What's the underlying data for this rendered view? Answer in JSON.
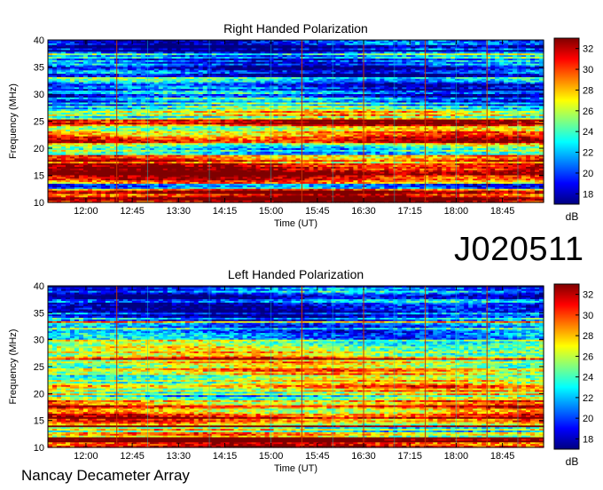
{
  "observation_id": "J020511",
  "instrument_label": "Nancay Decameter Array",
  "colors": {
    "colormap": [
      "#00007f",
      "#0000ff",
      "#0080ff",
      "#00ffff",
      "#80ff80",
      "#ffff00",
      "#ff8000",
      "#ff0000",
      "#7f0000"
    ],
    "reference_line": "#c83200",
    "hour_line": "#00dcdc"
  },
  "chart_data": [
    {
      "type": "heatmap",
      "title": "Right Handed Polarization",
      "xlabel": "Time (UT)",
      "ylabel": "Frequency (MHz)",
      "x_ticks": [
        "12:00",
        "12:45",
        "13:30",
        "14:15",
        "15:00",
        "15:45",
        "16:30",
        "17:15",
        "18:00",
        "18:45"
      ],
      "xlim": [
        "11:23",
        "19:25"
      ],
      "y_ticks": [
        10,
        15,
        20,
        25,
        30,
        35,
        40
      ],
      "ylim": [
        10,
        40
      ],
      "colorbar": {
        "label": "dB",
        "ticks": [
          18,
          20,
          22,
          24,
          26,
          28,
          30,
          32
        ],
        "range": [
          17,
          33
        ]
      },
      "reference_lines_ut": [
        "12:30",
        "15:30",
        "16:30",
        "17:30",
        "18:30"
      ],
      "band_profile": [
        {
          "freq": 11.5,
          "db": 32
        },
        {
          "freq": 13.0,
          "db": 22
        },
        {
          "freq": 15.0,
          "db": 33
        },
        {
          "freq": 17.5,
          "db": 29
        },
        {
          "freq": 19.5,
          "db": 24
        },
        {
          "freq": 21.5,
          "db": 30
        },
        {
          "freq": 23.5,
          "db": 27
        },
        {
          "freq": 26.0,
          "db": 26
        },
        {
          "freq": 29.0,
          "db": 22
        },
        {
          "freq": 33.0,
          "db": 20
        },
        {
          "freq": 37.0,
          "db": 19
        },
        {
          "freq": 39.5,
          "db": 18
        }
      ]
    },
    {
      "type": "heatmap",
      "title": "Left Handed Polarization",
      "xlabel": "Time (UT)",
      "ylabel": "Frequency (MHz)",
      "x_ticks": [
        "12:00",
        "12:45",
        "13:30",
        "14:15",
        "15:00",
        "15:45",
        "16:30",
        "17:15",
        "18:00",
        "18:45"
      ],
      "xlim": [
        "11:23",
        "19:25"
      ],
      "y_ticks": [
        10,
        15,
        20,
        25,
        30,
        35,
        40
      ],
      "ylim": [
        10,
        40
      ],
      "colorbar": {
        "label": "dB",
        "ticks": [
          18,
          20,
          22,
          24,
          26,
          28,
          30,
          32
        ],
        "range": [
          17,
          33
        ]
      },
      "reference_lines_ut": [
        "12:30",
        "15:30",
        "16:30",
        "17:30",
        "18:30"
      ],
      "band_profile": [
        {
          "freq": 11.5,
          "db": 32
        },
        {
          "freq": 13.0,
          "db": 24
        },
        {
          "freq": 15.0,
          "db": 31
        },
        {
          "freq": 17.5,
          "db": 29
        },
        {
          "freq": 19.5,
          "db": 25
        },
        {
          "freq": 21.5,
          "db": 29
        },
        {
          "freq": 23.5,
          "db": 26
        },
        {
          "freq": 26.5,
          "db": 27
        },
        {
          "freq": 29.5,
          "db": 23
        },
        {
          "freq": 33.0,
          "db": 21
        },
        {
          "freq": 37.0,
          "db": 20
        },
        {
          "freq": 39.5,
          "db": 19
        }
      ]
    }
  ]
}
